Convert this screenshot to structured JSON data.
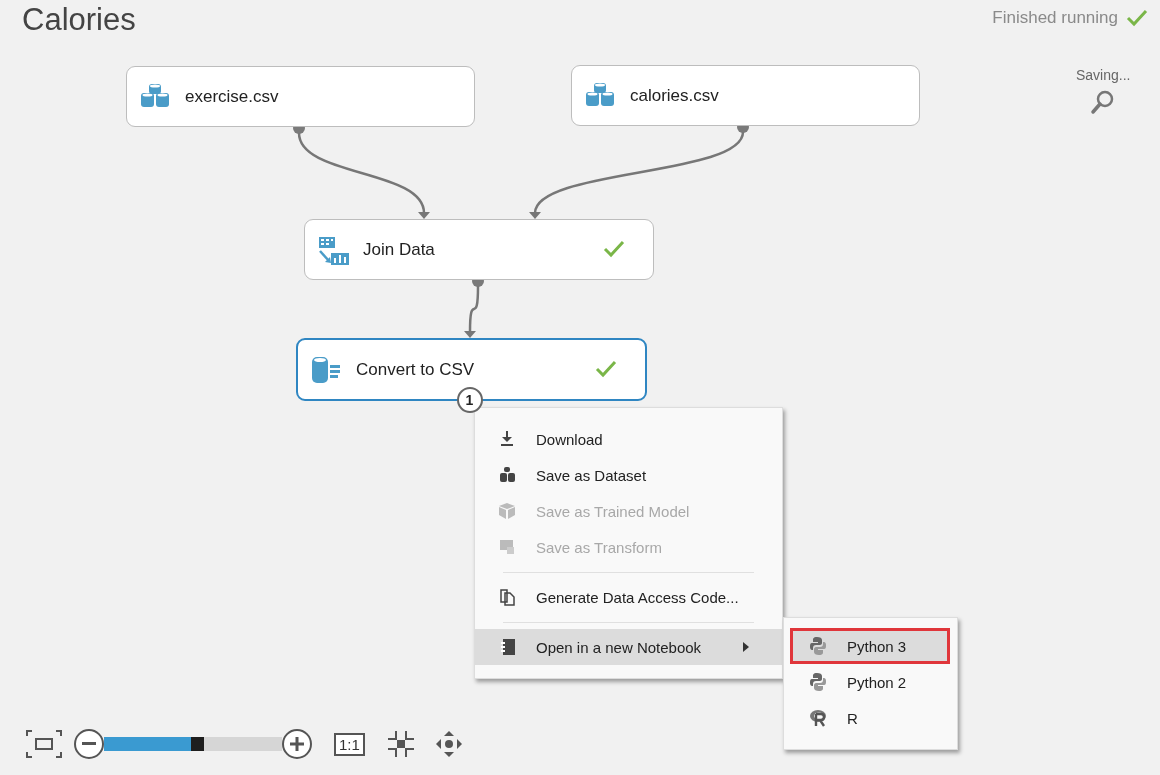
{
  "title": "Calories",
  "run_status": {
    "text": "Finished running",
    "done": true
  },
  "save_status": "Saving...",
  "nodes": [
    {
      "label": "exercise.csv",
      "kind": "dataset",
      "selected": false,
      "done": false
    },
    {
      "label": "calories.csv",
      "kind": "dataset",
      "selected": false,
      "done": false
    },
    {
      "label": "Join Data",
      "kind": "join",
      "selected": false,
      "done": true
    },
    {
      "label": "Convert to CSV",
      "kind": "convert",
      "selected": true,
      "done": true,
      "port_badge": "1"
    }
  ],
  "context_menu": [
    {
      "kind": "item",
      "label": "Download",
      "disabled": false,
      "selected": false,
      "submenu": false
    },
    {
      "kind": "item",
      "label": "Save as Dataset",
      "disabled": false,
      "selected": false,
      "submenu": false
    },
    {
      "kind": "item",
      "label": "Save as Trained Model",
      "disabled": true,
      "selected": false,
      "submenu": false
    },
    {
      "kind": "item",
      "label": "Save as Transform",
      "disabled": true,
      "selected": false,
      "submenu": false
    },
    {
      "kind": "separator"
    },
    {
      "kind": "item",
      "label": "Generate Data Access Code...",
      "disabled": false,
      "selected": false,
      "submenu": false
    },
    {
      "kind": "separator"
    },
    {
      "kind": "item",
      "label": "Open in a new Notebook",
      "disabled": false,
      "selected": true,
      "submenu": true
    }
  ],
  "submenu": [
    {
      "label": "Python 3",
      "selected": true
    },
    {
      "label": "Python 2",
      "selected": false
    },
    {
      "label": "R",
      "selected": false
    }
  ],
  "zoom": {
    "level": 0.52,
    "actual_size_label": "1:1"
  }
}
